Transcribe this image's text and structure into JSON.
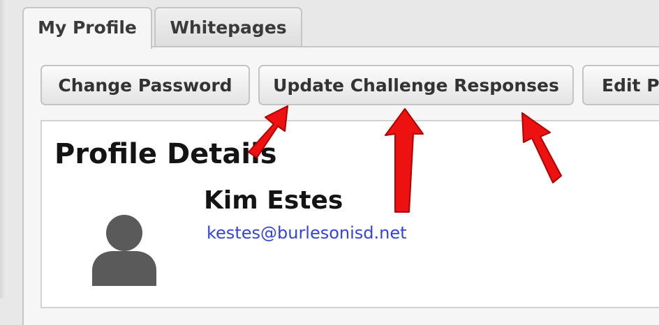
{
  "tabs": [
    {
      "label": "My Profile",
      "active": true
    },
    {
      "label": "Whitepages",
      "active": false
    }
  ],
  "toolbar": {
    "change_password": "Change Password",
    "update_challenge": "Update Challenge Responses",
    "edit_profile": "Edit P"
  },
  "profile": {
    "heading": "Profile Details",
    "name": "Kim Estes",
    "email": "kestes@burlesonisd.net"
  },
  "icons": {
    "avatar": "user-avatar-icon",
    "annotation": "red-arrow-icon"
  },
  "colors": {
    "link": "#3344dd",
    "annotation": "#ee1111"
  }
}
